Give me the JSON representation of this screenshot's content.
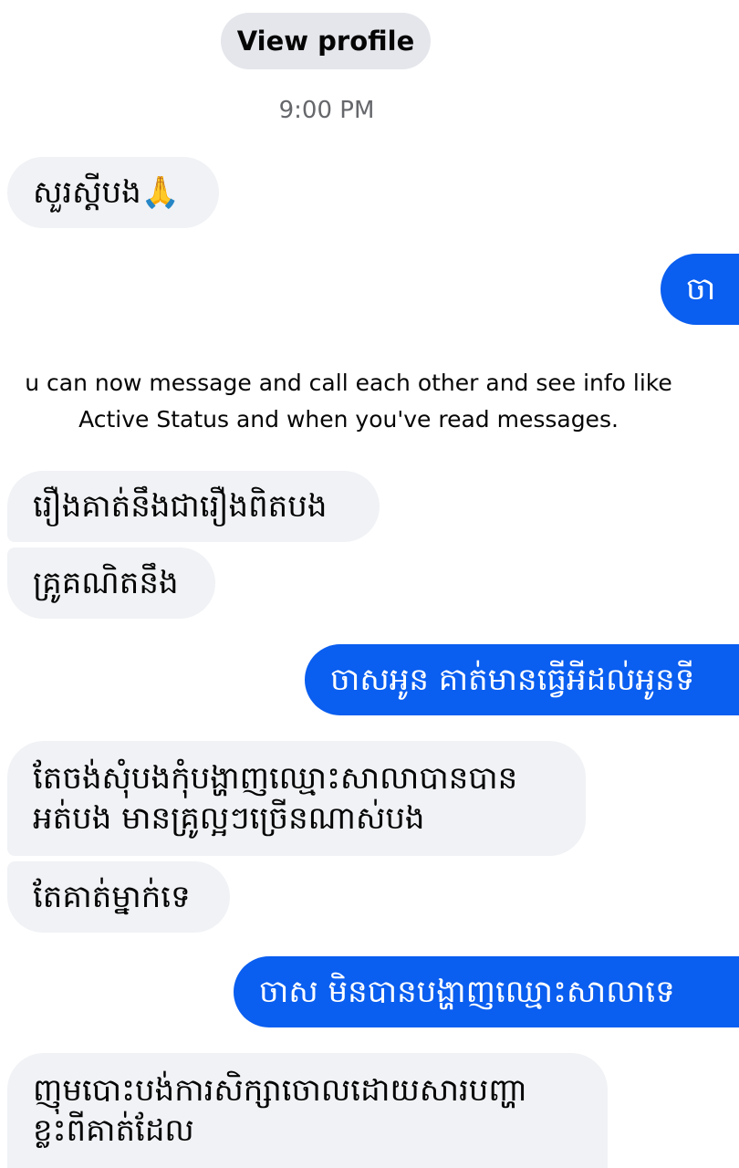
{
  "header": {
    "view_profile_label": "View profile",
    "timestamp": "9:00 PM"
  },
  "system_notice": {
    "line1": "u can now message and call each other and see info like",
    "line2": "Active Status and when you've read messages."
  },
  "messages": [
    {
      "direction": "incoming",
      "text": "សួរស្ដីបង🙏"
    },
    {
      "direction": "outgoing",
      "text": "ចា"
    },
    {
      "direction": "incoming",
      "text": "រឿងគាត់នឹងជារឿងពិតបង"
    },
    {
      "direction": "incoming",
      "text": "គ្រូគណិតនឹង"
    },
    {
      "direction": "outgoing",
      "text": "ចាសអូន គាត់មានធ្វើអីដល់អូនទី"
    },
    {
      "direction": "incoming",
      "lines": [
        "តែចង់សុំបងកុំបង្ហាញឈ្មោះសាលាបានបាន",
        "អត់បង មានគ្រូល្អៗច្រើនណាស់បង"
      ]
    },
    {
      "direction": "incoming",
      "text": "តែគាត់ម្នាក់ទេ"
    },
    {
      "direction": "outgoing",
      "text": "ចាស មិនបានបង្ហាញឈ្មោះសាលាទេ"
    },
    {
      "direction": "incoming",
      "lines": [
        "ញុមបោះបង់ការសិក្សាចោលដោយសារបញ្ហា",
        "ខ្លះពីគាត់ដែល"
      ]
    }
  ],
  "colors": {
    "outgoing_bubble": "#0a5ef0",
    "incoming_bubble": "#f0f2f5",
    "view_profile_bg": "#e4e6eb",
    "timestamp_text": "#65676b"
  }
}
